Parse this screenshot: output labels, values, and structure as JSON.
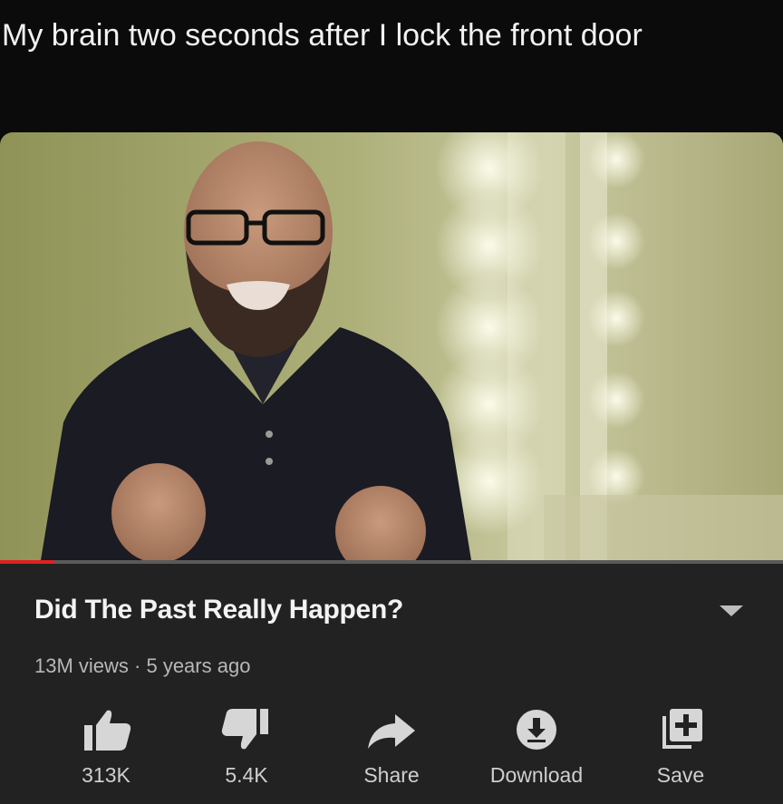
{
  "caption": "My brain two seconds after I lock the front door",
  "player": {
    "progress_fraction": 0.07,
    "image_description": "man with glasses and beard in dark polo shirt talking in front of mirror lights"
  },
  "video": {
    "title": "Did The Past Really Happen?",
    "meta": "13M views · 5 years ago"
  },
  "actions": {
    "like": {
      "label": "313K",
      "icon": "thumbs-up-icon"
    },
    "dislike": {
      "label": "5.4K",
      "icon": "thumbs-down-icon"
    },
    "share": {
      "label": "Share",
      "icon": "share-arrow-icon"
    },
    "download": {
      "label": "Download",
      "icon": "download-icon"
    },
    "save": {
      "label": "Save",
      "icon": "add-to-playlist-icon"
    }
  },
  "colors": {
    "progress": "#e02020",
    "panel": "#222222",
    "background": "#0b0b0b"
  }
}
